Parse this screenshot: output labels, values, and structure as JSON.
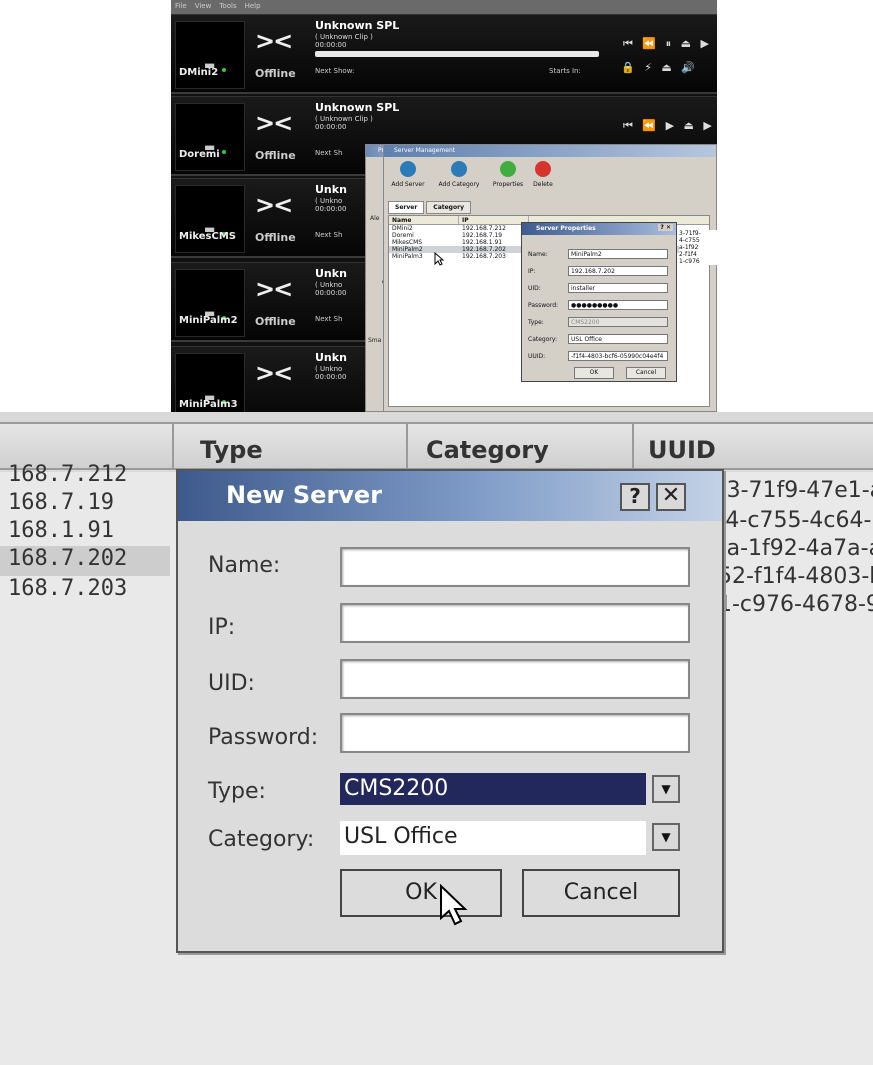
{
  "menubar": {
    "items": [
      "File",
      "View",
      "Tools",
      "Help"
    ]
  },
  "devices": [
    {
      "name": "DMini2",
      "status": "Offline",
      "title": "Unknown SPL",
      "clip": "( Unknown Clip )",
      "time": "00:00:00",
      "next_show": "Next Show:",
      "starts_in": "Starts In:"
    },
    {
      "name": "Doremi",
      "status": "Offline",
      "title": "Unknown SPL",
      "clip": "( Unknown Clip )",
      "time": "00:00:00",
      "next_show": "Next Sh",
      "starts_in": ""
    },
    {
      "name": "MikesCMS",
      "status": "Offline",
      "title": "Unkn",
      "clip": "( Unkno",
      "time": "00:00:00",
      "next_show": "Next Sh",
      "starts_in": ""
    },
    {
      "name": "MiniPalm2",
      "status": "Offline",
      "title": "Unkn",
      "clip": "( Unkno",
      "time": "00:00:00",
      "next_show": "Next Sh",
      "starts_in": ""
    },
    {
      "name": "MiniPalm3",
      "status": "",
      "title": "Unkn",
      "clip": "( Unkno",
      "time": "00:00:00",
      "next_show": "",
      "starts_in": ""
    }
  ],
  "preferences": {
    "title": "Pref",
    "label_ale": "Ale",
    "label_g": "G",
    "label_sma": "Sma"
  },
  "server_management": {
    "title": "Server Management",
    "toolbar": {
      "add_server": "Add Server",
      "add_category": "Add Category",
      "properties": "Properties",
      "delete": "Delete"
    },
    "tabs": [
      "Server",
      "Category"
    ],
    "columns": [
      "Name",
      "IP"
    ],
    "rows": [
      {
        "name": "DMini2",
        "ip": "192.168.7.212"
      },
      {
        "name": "Doremi",
        "ip": "192.168.7.19"
      },
      {
        "name": "MikesCMS",
        "ip": "192.168.1.91"
      },
      {
        "name": "MiniPalm2",
        "ip": "192.168.7.202"
      },
      {
        "name": "MiniPalm3",
        "ip": "192.168.7.203"
      }
    ],
    "right_uuids": [
      "3-71f9-",
      "4-c755",
      "a-1f92",
      "2-f1f4",
      "1-c976"
    ]
  },
  "server_properties": {
    "title": "Server Properties",
    "help": "?",
    "close": "✕",
    "fields": {
      "name_label": "Name:",
      "name_value": "MiniPalm2",
      "ip_label": "IP:",
      "ip_value": "192.168.7.202",
      "uid_label": "UID:",
      "uid_value": "installer",
      "password_label": "Password:",
      "password_value": "●●●●●●●●●",
      "type_label": "Type:",
      "type_value": "CMS2200",
      "category_label": "Category:",
      "category_value": "USL Office",
      "uuid_label": "UUID:",
      "uuid_value": "-f1f4-4803-bcf6-05990c04e4f4"
    },
    "ok": "OK",
    "cancel": "Cancel"
  },
  "zoom_list": {
    "columns": {
      "type": "Type",
      "category": "Category",
      "uuid": "UUID"
    },
    "ips": [
      "168.7.212",
      "168.7.19",
      "168.1.91",
      "168.7.202",
      "168.7.203"
    ],
    "uuids": [
      ")3-71f9-47e1-a",
      ":4-c755-4c64-b",
      ")a-1f92-4a7a-a",
      "52-f1f4-4803-b",
      "1-c976-4678-9"
    ]
  },
  "new_server": {
    "title": "New Server",
    "help": "?",
    "close": "✕",
    "name_label": "Name:",
    "name_value": "",
    "ip_label": "IP:",
    "ip_value": "",
    "uid_label": "UID:",
    "uid_value": "",
    "password_label": "Password:",
    "password_value": "",
    "type_label": "Type:",
    "type_value": "CMS2200",
    "category_label": "Category:",
    "category_value": "USL Office",
    "ok": "OK",
    "cancel": "Cancel"
  },
  "colors": {
    "dialog_title_start": "#3d5a8c",
    "selected_dropdown": "#23285c",
    "status_led": "#2ecc40"
  }
}
